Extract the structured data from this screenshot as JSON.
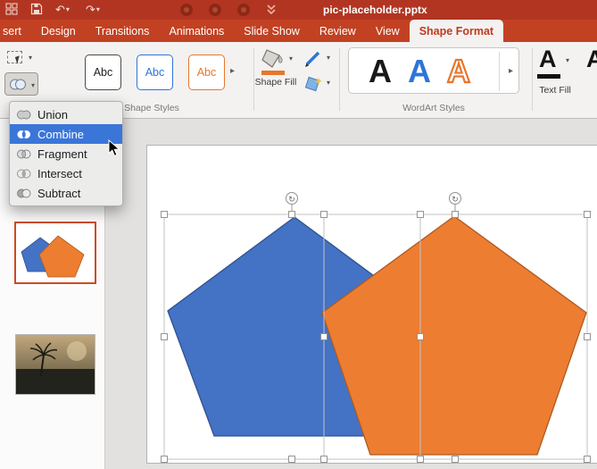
{
  "titlebar": {
    "title": "pic-placeholder.pptx"
  },
  "tabs": {
    "items": [
      {
        "label": "sert",
        "active": false
      },
      {
        "label": "Design",
        "active": false
      },
      {
        "label": "Transitions",
        "active": false
      },
      {
        "label": "Animations",
        "active": false
      },
      {
        "label": "Slide Show",
        "active": false
      },
      {
        "label": "Review",
        "active": false
      },
      {
        "label": "View",
        "active": false
      },
      {
        "label": "Shape Format",
        "active": true
      }
    ]
  },
  "ribbon": {
    "style_presets": [
      {
        "label": "Abc"
      },
      {
        "label": "Abc"
      },
      {
        "label": "Abc"
      }
    ],
    "groups": {
      "shape_styles": "Shape Styles",
      "wordart_styles": "WordArt Styles"
    },
    "shape_fill_label": "Shape Fill",
    "text_fill_label": "Text Fill",
    "wordart_letters": [
      {
        "glyph": "A",
        "style": "black"
      },
      {
        "glyph": "A",
        "style": "blue"
      },
      {
        "glyph": "A",
        "style": "orange-outline"
      }
    ],
    "text_fill_letter": "A",
    "text_outline_letter": "A"
  },
  "merge_menu": {
    "items": [
      {
        "label": "Union",
        "selected": false
      },
      {
        "label": "Combine",
        "selected": true
      },
      {
        "label": "Fragment",
        "selected": false
      },
      {
        "label": "Intersect",
        "selected": false
      },
      {
        "label": "Subtract",
        "selected": false
      }
    ]
  },
  "slide": {
    "shapes": [
      {
        "name": "pentagon",
        "fill": "#4472c4"
      },
      {
        "name": "pentagon",
        "fill": "#ed7d31"
      }
    ],
    "selection": {
      "shape_count": 2
    }
  },
  "colors": {
    "titlebar_red": "#b23522",
    "tab_red": "#c24122",
    "active_tab_text": "#c03a1e",
    "menu_selection_blue": "#3a76d8",
    "pentagon_blue": "#4472c4",
    "pentagon_orange": "#ed7d31",
    "thumb_selected_border": "#ce4a24"
  }
}
